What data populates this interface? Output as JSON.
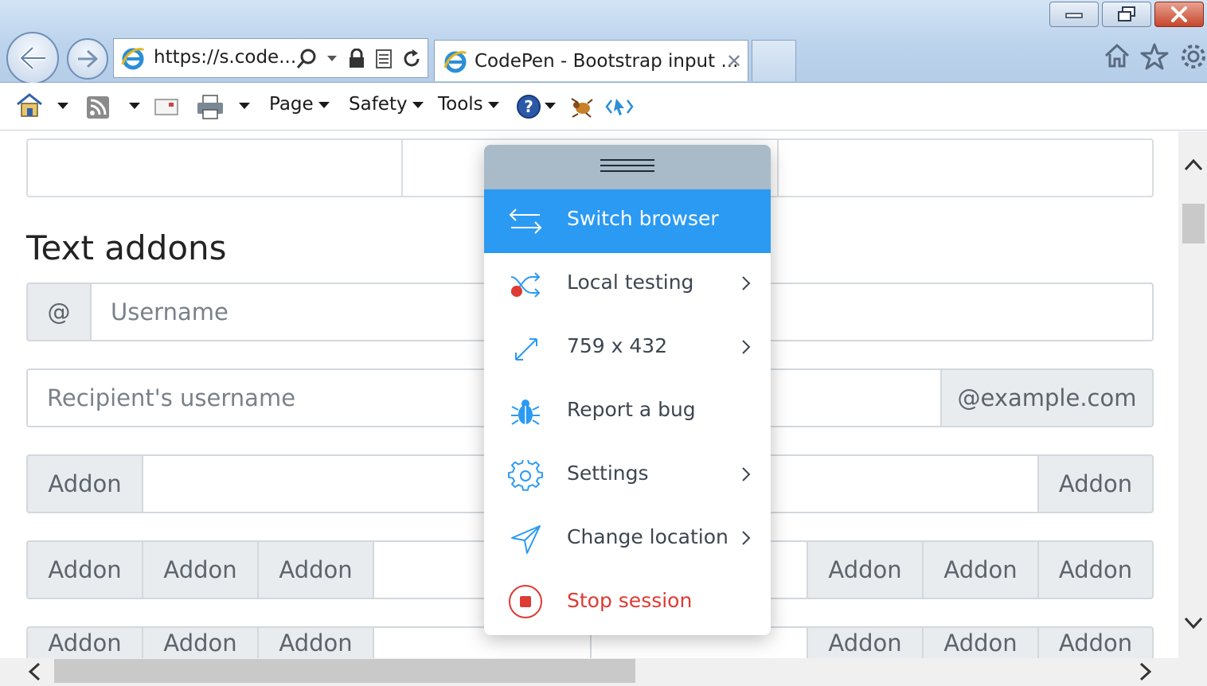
{
  "browser": {
    "address_text": "https://s.code...",
    "tab_title": "CodePen - Bootstrap input ...",
    "tab_close": "✕",
    "commands": {
      "page": "Page",
      "safety": "Safety",
      "tools": "Tools"
    }
  },
  "page": {
    "heading": "Text addons",
    "row1": {
      "addon": "@",
      "placeholder": "Username"
    },
    "row2": {
      "placeholder": "Recipient's username",
      "addon": "@example.com"
    },
    "row3": {
      "left_addon": "Addon",
      "right_addon": "Addon"
    },
    "row4": {
      "addons_left": [
        "Addon",
        "Addon",
        "Addon"
      ],
      "addons_right": [
        "Addon",
        "Addon",
        "Addon"
      ]
    },
    "row5": {
      "addons_left": [
        "Addon",
        "Addon",
        "Addon"
      ],
      "addons_right": [
        "Addon",
        "Addon",
        "Addon"
      ]
    }
  },
  "menu": {
    "items": [
      {
        "label": "Switch browser",
        "icon": "switch-arrows-icon",
        "active": true
      },
      {
        "label": "Local testing",
        "icon": "shuffle-icon",
        "submenu": true
      },
      {
        "label": "759 x 432",
        "icon": "resize-icon",
        "submenu": true
      },
      {
        "label": "Report a bug",
        "icon": "bug-icon"
      },
      {
        "label": "Settings",
        "icon": "gear-icon",
        "submenu": true
      },
      {
        "label": "Change location",
        "icon": "location-arrow-icon",
        "submenu": true
      },
      {
        "label": "Stop session",
        "icon": "stop-icon",
        "danger": true
      }
    ]
  },
  "colors": {
    "accent": "#2b9af3",
    "danger": "#dd3b33",
    "menu_handle": "#a9bac8",
    "addon_bg": "#e9ecef"
  }
}
